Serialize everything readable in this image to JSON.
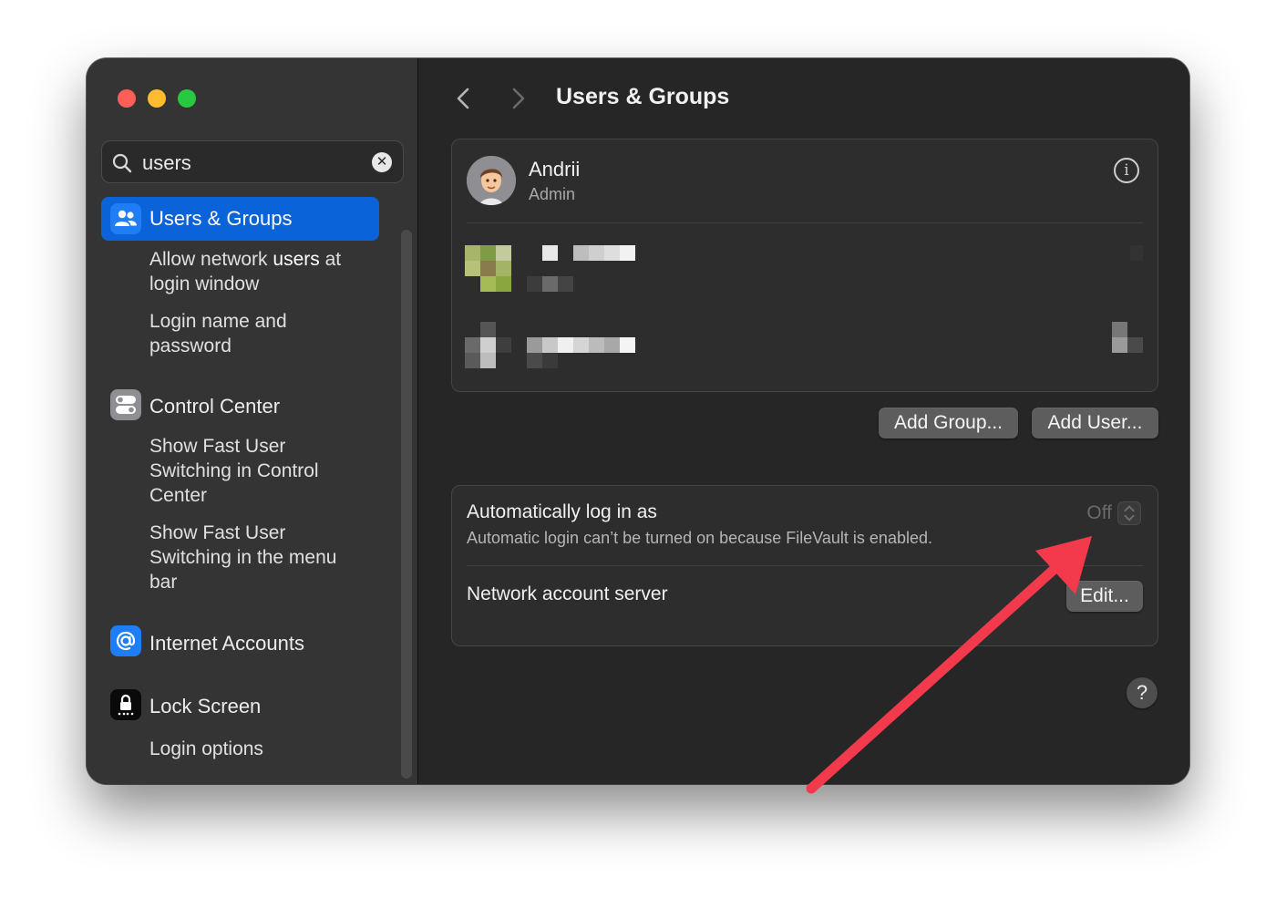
{
  "window": {
    "title": "Users & Groups"
  },
  "search": {
    "value": "users",
    "clear_icon": "clear-icon"
  },
  "sidebar": {
    "items": [
      {
        "label": "Users & Groups",
        "icon": "users-icon",
        "selected": true,
        "subitems": [
          {
            "pre": "Allow network ",
            "match": "users",
            "post": " at login window"
          },
          {
            "label": "Login name and password"
          }
        ]
      },
      {
        "label": "Control Center",
        "icon": "control-center-icon",
        "subitems": [
          {
            "label": "Show Fast User Switching in Control Center"
          },
          {
            "label": "Show Fast User Switching in the menu bar"
          }
        ]
      },
      {
        "label": "Internet Accounts",
        "icon": "at-sign-icon",
        "subitems": []
      },
      {
        "label": "Lock Screen",
        "icon": "lock-icon",
        "subitems": [
          {
            "label": "Login options"
          }
        ]
      }
    ]
  },
  "users": {
    "primary": {
      "name": "Andrii",
      "role": "Admin"
    }
  },
  "buttons": {
    "add_group": "Add Group...",
    "add_user": "Add User...",
    "edit": "Edit..."
  },
  "login": {
    "auto_login_title": "Automatically log in as",
    "auto_login_value": "Off",
    "auto_login_note": "Automatic login can’t be turned on because FileVault is enabled.",
    "network_server_title": "Network account server"
  },
  "help": {
    "label": "?"
  },
  "colors": {
    "accent": "#0a63d8",
    "annotation_arrow": "#f23a4c"
  }
}
